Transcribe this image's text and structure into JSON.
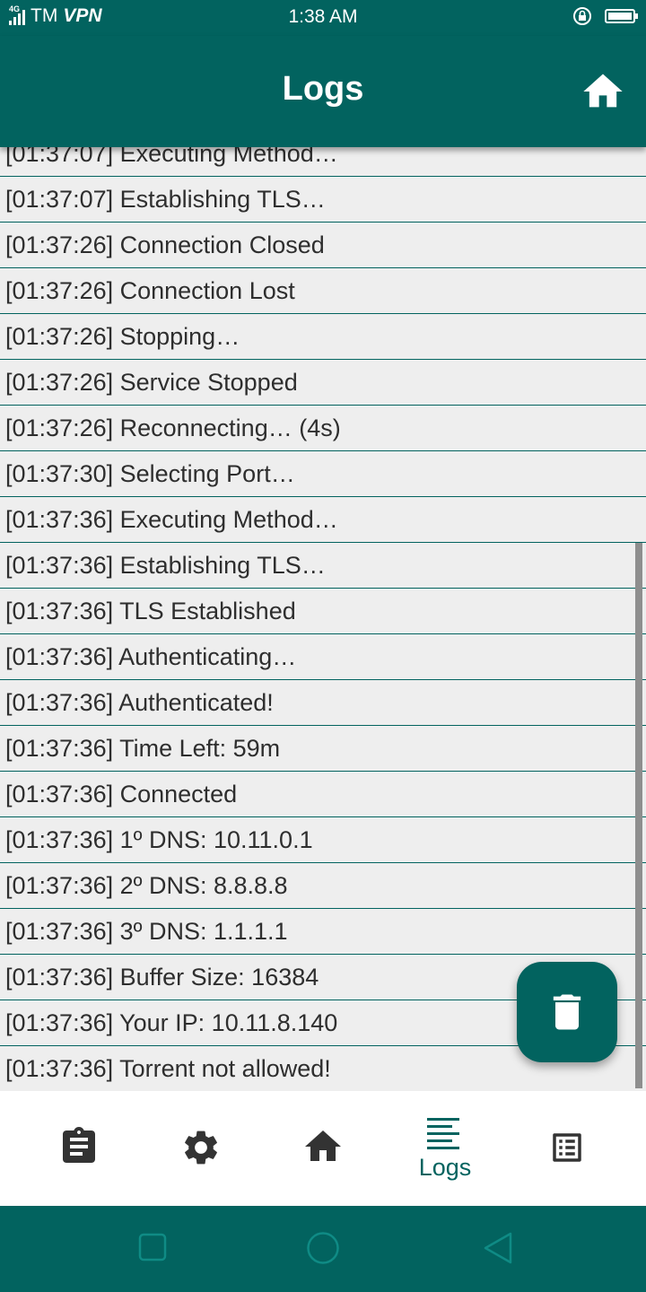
{
  "status_bar": {
    "network": "4G",
    "carrier": "TM",
    "vpn": "VPN",
    "time": "1:38 AM",
    "icons": [
      "signal-icon",
      "vpn-lock-icon",
      "battery-icon"
    ]
  },
  "app_bar": {
    "title": "Logs",
    "home_icon": "home-icon"
  },
  "logs": [
    "[01:37:07] Executing Method…",
    "[01:37:07] Establishing TLS…",
    "[01:37:26] Connection Closed",
    "[01:37:26] Connection Lost",
    "[01:37:26] Stopping…",
    "[01:37:26] Service Stopped",
    "[01:37:26] Reconnecting… (4s)",
    "[01:37:30] Selecting Port…",
    "[01:37:36] Executing Method…",
    "[01:37:36] Establishing TLS…",
    "[01:37:36] TLS Established",
    "[01:37:36] Authenticating…",
    "[01:37:36] Authenticated!",
    "[01:37:36] Time Left: 59m",
    "[01:37:36] Connected",
    "[01:37:36] 1º DNS: 10.11.0.1",
    "[01:37:36] 2º DNS: 8.8.8.8",
    "[01:37:36] 3º DNS: 1.1.1.1",
    "[01:37:36] Buffer Size: 16384",
    "[01:37:36] Your IP: 10.11.8.140",
    "[01:37:36] Torrent not allowed!"
  ],
  "fab": {
    "icon": "trash-icon"
  },
  "bottom_nav": {
    "items": [
      {
        "icon": "clipboard-icon",
        "label": ""
      },
      {
        "icon": "gear-icon",
        "label": ""
      },
      {
        "icon": "home-icon",
        "label": ""
      },
      {
        "icon": "logs-icon",
        "label": "Logs",
        "active": true
      },
      {
        "icon": "list-icon",
        "label": ""
      }
    ]
  },
  "system_nav": {
    "icons": [
      "recents-icon",
      "home-circle-icon",
      "back-icon"
    ]
  },
  "colors": {
    "primary": "#02635f",
    "row_background": "#eeeeee",
    "nav_icon": "#333333",
    "nav_active": "#02635f"
  }
}
